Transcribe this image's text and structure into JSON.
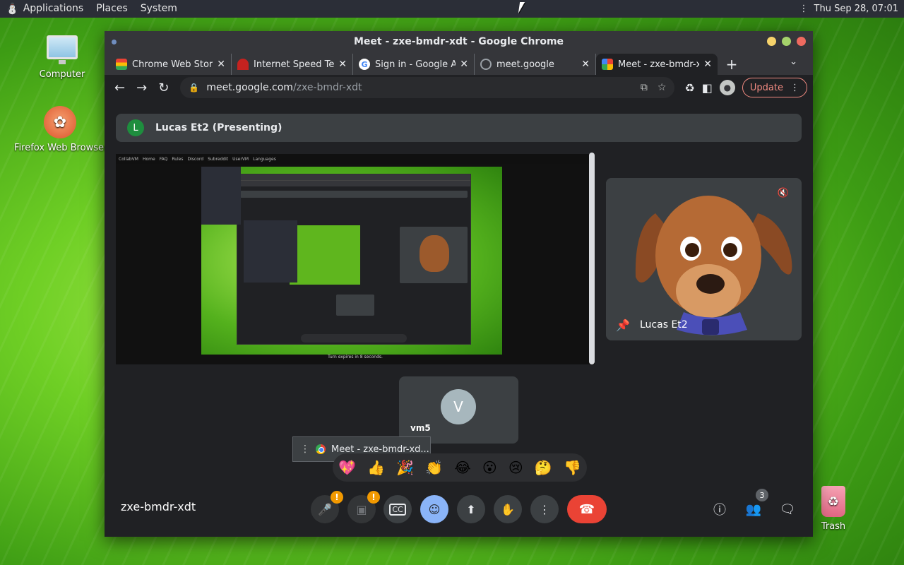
{
  "panel": {
    "menus": [
      "Applications",
      "Places",
      "System"
    ],
    "clock": "Thu Sep 28, 07:01"
  },
  "desktop": {
    "icons": [
      {
        "label": "Computer",
        "icon": "monitor-icon"
      },
      {
        "label": "Firefox Web Browser",
        "icon": "firefox-icon"
      },
      {
        "label": "Trash",
        "icon": "trash-icon"
      }
    ]
  },
  "window": {
    "title": "Meet - zxe-bmdr-xdt - Google Chrome",
    "tabs": [
      {
        "title": "Chrome Web Store",
        "icon": "chrome-web-store-icon",
        "active": false
      },
      {
        "title": "Internet Speed Test",
        "icon": "speedtest-icon",
        "active": false
      },
      {
        "title": "Sign in - Google Accounts",
        "icon": "google-icon",
        "active": false
      },
      {
        "title": "meet.google",
        "icon": "globe-icon",
        "active": false
      },
      {
        "title": "Meet - zxe-bmdr-xdt",
        "icon": "meet-icon",
        "active": true
      }
    ],
    "url_host": "meet.google.com",
    "url_path": "/zxe-bmdr-xdt",
    "update_label": "Update"
  },
  "meet": {
    "presenter_initial": "L",
    "presenting_label": "Lucas Et2 (Presenting)",
    "pinned_name": "Lucas Et2",
    "vm_initial": "V",
    "vm_name": "vm5",
    "share_popup_label": "Meet - zxe-bmdr-xd...",
    "reactions": [
      "💖",
      "👍",
      "🎉",
      "👏",
      "😂",
      "😮",
      "😢",
      "🤔",
      "👎"
    ],
    "meeting_code": "zxe-bmdr-xdt",
    "people_count": "3",
    "alert_mark": "!",
    "screen_share": {
      "top_items": [
        "CollabVM",
        "Home",
        "FAQ",
        "Rules",
        "Discord",
        "Subreddit",
        "UserVM",
        "Languages"
      ],
      "caption": "Turn expires in 8 seconds."
    }
  },
  "colors": {
    "end_call": "#ea4335",
    "reactions_button": "#8ab4f8",
    "update_border": "#f28b82",
    "panel_bg": "#2b2e37"
  }
}
